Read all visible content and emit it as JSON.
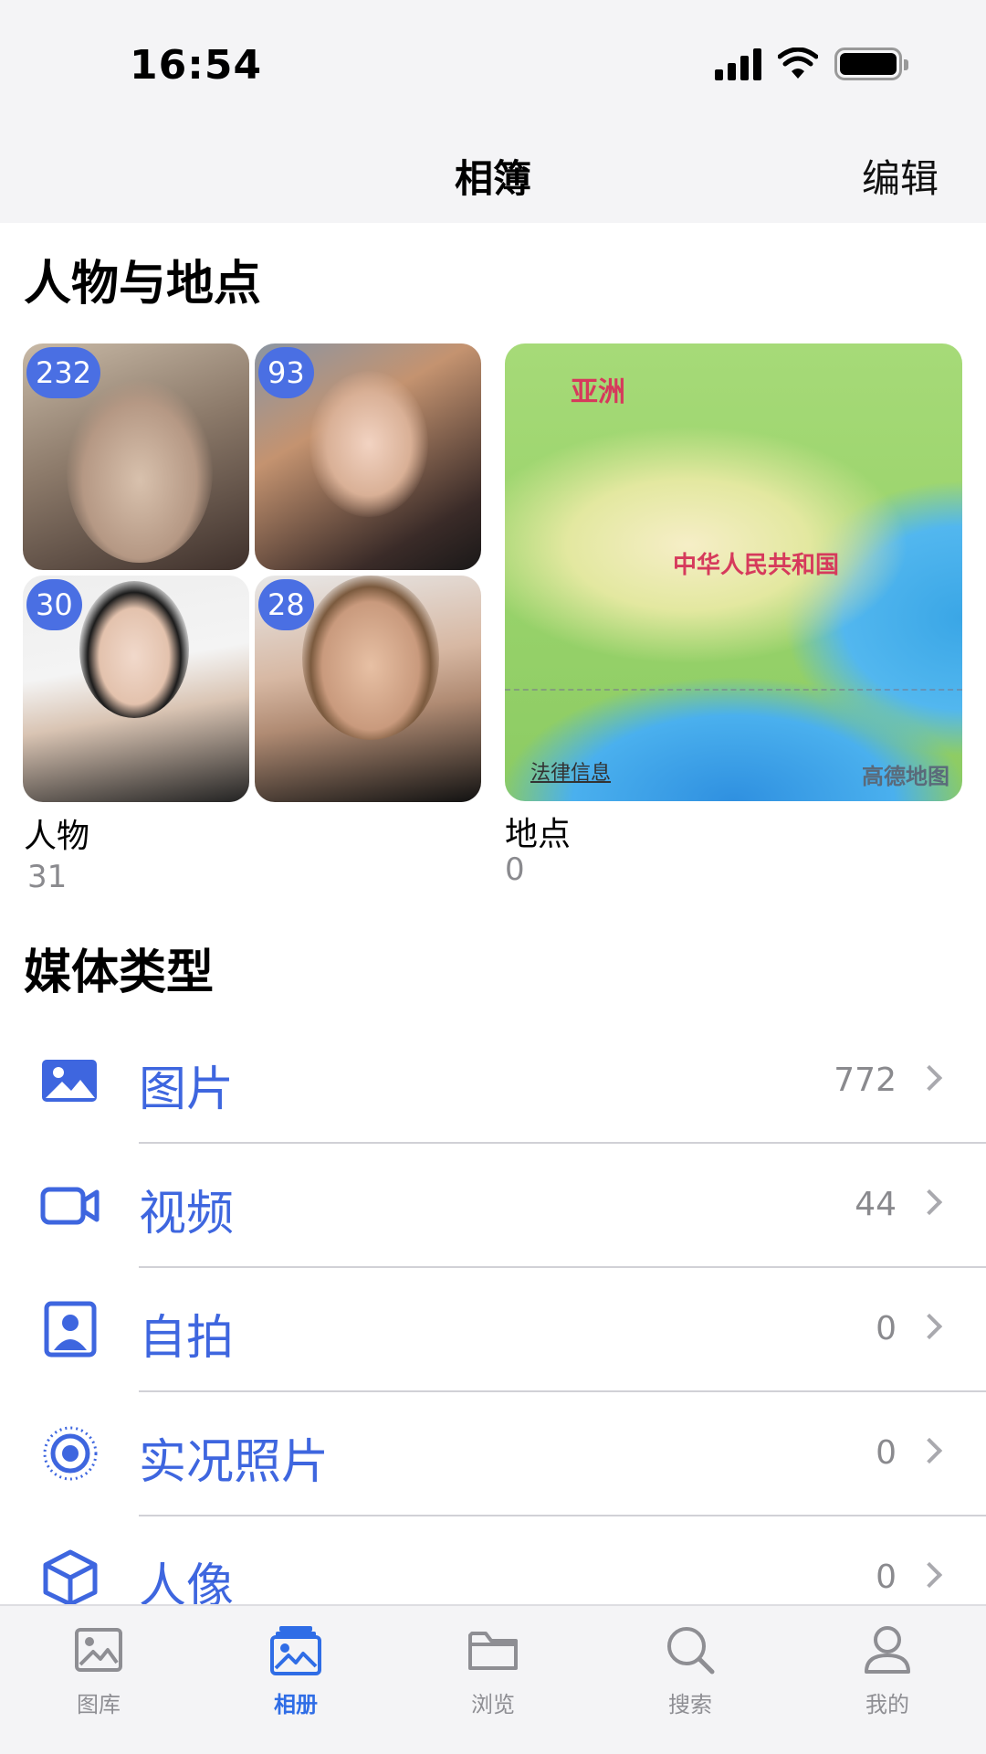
{
  "status_bar": {
    "time": "16:54"
  },
  "nav": {
    "title": "相簿",
    "edit_label": "编辑"
  },
  "people_places": {
    "section_title": "人物与地点",
    "people": {
      "label": "人物",
      "count": "31",
      "badges": [
        "232",
        "93",
        "30",
        "28"
      ]
    },
    "places": {
      "label": "地点",
      "count": "0",
      "map_labels": {
        "continent": "亚洲",
        "country": "中华人民共和国",
        "legal": "法律信息",
        "brand": "高德地图"
      }
    }
  },
  "media_types": {
    "section_title": "媒体类型",
    "items": [
      {
        "label": "图片",
        "count": "772",
        "icon": "photo-icon"
      },
      {
        "label": "视频",
        "count": "44",
        "icon": "video-icon"
      },
      {
        "label": "自拍",
        "count": "0",
        "icon": "selfie-icon"
      },
      {
        "label": "实况照片",
        "count": "0",
        "icon": "live-photo-icon"
      },
      {
        "label": "人像",
        "count": "0",
        "icon": "portrait-cube-icon"
      }
    ]
  },
  "tab_bar": {
    "active": "相册",
    "tabs": [
      {
        "label": "图库",
        "icon": "library-icon"
      },
      {
        "label": "相册",
        "icon": "albums-icon"
      },
      {
        "label": "浏览",
        "icon": "folder-icon"
      },
      {
        "label": "搜索",
        "icon": "search-icon"
      },
      {
        "label": "我的",
        "icon": "profile-icon"
      }
    ]
  },
  "colors": {
    "accent": "#3e66df",
    "badge": "#4a6fe3",
    "tab_active": "#2f6de6",
    "secondary_text": "#8a8a8e"
  }
}
